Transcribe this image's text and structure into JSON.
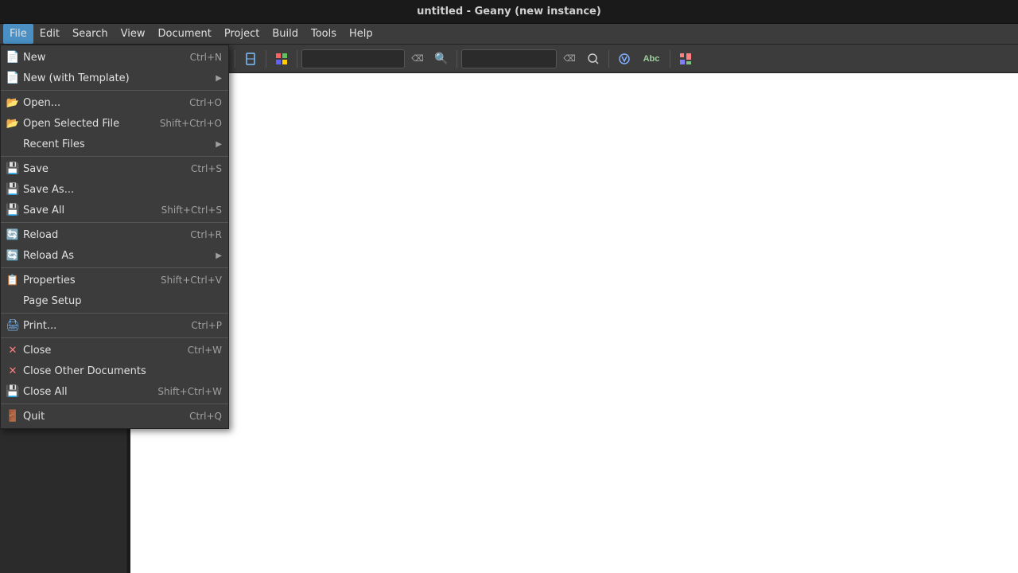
{
  "titlebar": {
    "text": "untitled - Geany (new instance)"
  },
  "menubar": {
    "items": [
      {
        "label": "File",
        "active": true
      },
      {
        "label": "Edit",
        "active": false
      },
      {
        "label": "Search",
        "active": false
      },
      {
        "label": "View",
        "active": false
      },
      {
        "label": "Document",
        "active": false
      },
      {
        "label": "Project",
        "active": false
      },
      {
        "label": "Build",
        "active": false
      },
      {
        "label": "Tools",
        "active": false
      },
      {
        "label": "Help",
        "active": false
      }
    ]
  },
  "file_menu": {
    "items": [
      {
        "id": "new",
        "label": "New",
        "shortcut": "Ctrl+N",
        "icon": "📄",
        "has_arrow": false
      },
      {
        "id": "new-template",
        "label": "New (with Template)",
        "shortcut": "",
        "icon": "📄",
        "has_arrow": true
      },
      {
        "id": "sep1",
        "type": "separator"
      },
      {
        "id": "open",
        "label": "Open...",
        "shortcut": "Ctrl+O",
        "icon": "📂",
        "has_arrow": false
      },
      {
        "id": "open-selected",
        "label": "Open Selected File",
        "shortcut": "Shift+Ctrl+O",
        "icon": "📂",
        "has_arrow": false
      },
      {
        "id": "recent",
        "label": "Recent Files",
        "shortcut": "",
        "icon": "",
        "has_arrow": true
      },
      {
        "id": "sep2",
        "type": "separator"
      },
      {
        "id": "save",
        "label": "Save",
        "shortcut": "Ctrl+S",
        "icon": "💾",
        "has_arrow": false
      },
      {
        "id": "save-as",
        "label": "Save As...",
        "shortcut": "",
        "icon": "💾",
        "has_arrow": false
      },
      {
        "id": "save-all",
        "label": "Save All",
        "shortcut": "Shift+Ctrl+S",
        "icon": "💾",
        "has_arrow": false
      },
      {
        "id": "sep3",
        "type": "separator"
      },
      {
        "id": "reload",
        "label": "Reload",
        "shortcut": "Ctrl+R",
        "icon": "🔄",
        "has_arrow": false
      },
      {
        "id": "reload-as",
        "label": "Reload As",
        "shortcut": "",
        "icon": "🔄",
        "has_arrow": true
      },
      {
        "id": "sep4",
        "type": "separator"
      },
      {
        "id": "properties",
        "label": "Properties",
        "shortcut": "Shift+Ctrl+V",
        "icon": "📋",
        "has_arrow": false
      },
      {
        "id": "page-setup",
        "label": "Page Setup",
        "shortcut": "",
        "icon": "",
        "has_arrow": false
      },
      {
        "id": "sep5",
        "type": "separator"
      },
      {
        "id": "print",
        "label": "Print...",
        "shortcut": "Ctrl+P",
        "icon": "🖨",
        "has_arrow": false
      },
      {
        "id": "sep6",
        "type": "separator"
      },
      {
        "id": "close",
        "label": "Close",
        "shortcut": "Ctrl+W",
        "icon": "✕",
        "has_arrow": false
      },
      {
        "id": "close-other",
        "label": "Close Other Documents",
        "shortcut": "",
        "icon": "✕",
        "has_arrow": false
      },
      {
        "id": "close-all",
        "label": "Close All",
        "shortcut": "Shift+Ctrl+W",
        "icon": "💾",
        "has_arrow": false
      },
      {
        "id": "sep7",
        "type": "separator"
      },
      {
        "id": "quit",
        "label": "Quit",
        "shortcut": "Ctrl+Q",
        "icon": "🚪",
        "has_arrow": false
      }
    ]
  },
  "toolbar": {
    "buttons": [
      "new",
      "open",
      "save",
      "close-x",
      "sep",
      "undo",
      "redo",
      "sep",
      "compile",
      "run",
      "sep",
      "bookmarks",
      "sep",
      "search-entry",
      "search-btn",
      "sep",
      "find-entry",
      "find-btn",
      "sep",
      "macro",
      "color-picker",
      "sep",
      "prefs"
    ]
  }
}
